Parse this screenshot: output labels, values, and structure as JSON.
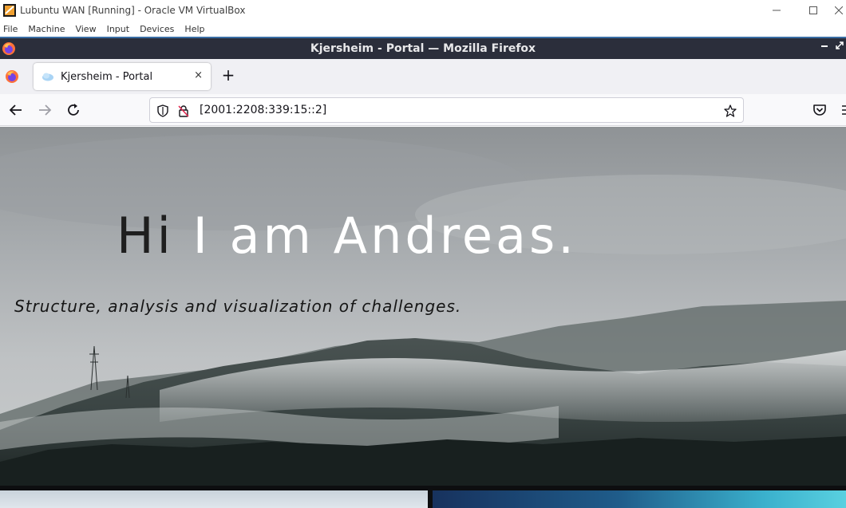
{
  "vbox": {
    "title": "Lubuntu WAN [Running] - Oracle VM VirtualBox",
    "menu": [
      "File",
      "Machine",
      "View",
      "Input",
      "Devices",
      "Help"
    ]
  },
  "firefox": {
    "window_title": "Kjersheim - Portal — Mozilla Firefox",
    "tab": {
      "label": "Kjersheim - Portal",
      "close": "×"
    },
    "new_tab": "+",
    "url": "[2001:2208:339:15::2]"
  },
  "page": {
    "greeting_dark": "Hi",
    "greeting_light": " I am Andreas.",
    "subtitle": "Structure, analysis and visualization of challenges."
  },
  "colors": {
    "firefox_titlebar": "#2b2e3b",
    "vbox_divider": "#3a6ea5",
    "card_right_gradient_end": "#59d0e0"
  }
}
